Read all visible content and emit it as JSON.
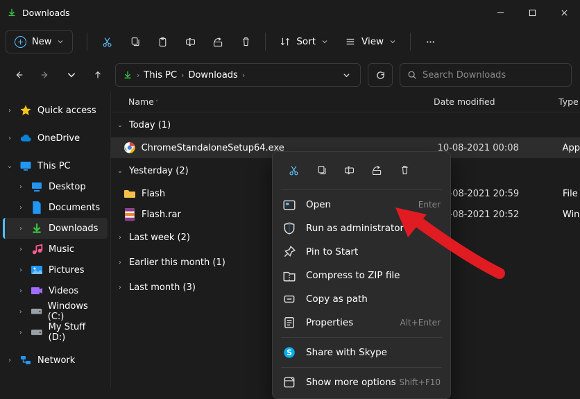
{
  "titlebar": {
    "title": "Downloads"
  },
  "toolbar": {
    "new_label": "New",
    "sort_label": "Sort",
    "view_label": "View"
  },
  "nav": {
    "crumbs": [
      "This PC",
      "Downloads"
    ],
    "search_placeholder": "Search Downloads"
  },
  "columns": {
    "name": "Name",
    "date": "Date modified",
    "type": "Type"
  },
  "sidebar": {
    "items": [
      {
        "label": "Quick access",
        "icon": "star",
        "color": "#f5c518",
        "expander": "›",
        "indent": false
      },
      {
        "label": "OneDrive",
        "icon": "cloud",
        "color": "#0a84d8",
        "expander": "›",
        "indent": false
      },
      {
        "label": "This PC",
        "icon": "monitor",
        "color": "#2196f3",
        "expander": "⌄",
        "indent": false
      },
      {
        "label": "Desktop",
        "icon": "desktop",
        "color": "#2196f3",
        "expander": "›",
        "indent": true
      },
      {
        "label": "Documents",
        "icon": "doc",
        "color": "#2196f3",
        "expander": "›",
        "indent": true
      },
      {
        "label": "Downloads",
        "icon": "download",
        "color": "#3ac143",
        "expander": "›",
        "indent": true,
        "selected": true
      },
      {
        "label": "Music",
        "icon": "music",
        "color": "#ff5a93",
        "expander": "›",
        "indent": true
      },
      {
        "label": "Pictures",
        "icon": "picture",
        "color": "#2196f3",
        "expander": "›",
        "indent": true
      },
      {
        "label": "Videos",
        "icon": "video",
        "color": "#a16cff",
        "expander": "›",
        "indent": true
      },
      {
        "label": "Windows (C:)",
        "icon": "drive",
        "color": "#9aa0a6",
        "expander": "›",
        "indent": true
      },
      {
        "label": "My Stuff (D:)",
        "icon": "drive",
        "color": "#9aa0a6",
        "expander": "›",
        "indent": true
      },
      {
        "label": "Network",
        "icon": "network",
        "color": "#2196f3",
        "expander": "›",
        "indent": false
      }
    ]
  },
  "groups": [
    {
      "label": "Today (1)",
      "expanded": true,
      "files": [
        {
          "name": "ChromeStandaloneSetup64.exe",
          "date": "10-08-2021 00:08",
          "type": "App",
          "icon": "chrome",
          "selected": true
        }
      ]
    },
    {
      "label": "Yesterday (2)",
      "expanded": true,
      "files": [
        {
          "name": "Flash",
          "date": "09-08-2021 20:59",
          "type": "File",
          "icon": "folder"
        },
        {
          "name": "Flash.rar",
          "date": "09-08-2021 20:52",
          "type": "Win",
          "icon": "rar"
        }
      ]
    },
    {
      "label": "Last week (2)",
      "expanded": false,
      "files": []
    },
    {
      "label": "Earlier this month (1)",
      "expanded": false,
      "files": []
    },
    {
      "label": "Last month (3)",
      "expanded": false,
      "files": []
    }
  ],
  "context_menu": {
    "items": [
      {
        "label": "Open",
        "icon": "open",
        "hint": "Enter"
      },
      {
        "label": "Run as administrator",
        "icon": "shield",
        "hint": ""
      },
      {
        "label": "Pin to Start",
        "icon": "pin",
        "hint": ""
      },
      {
        "label": "Compress to ZIP file",
        "icon": "zip",
        "hint": ""
      },
      {
        "label": "Copy as path",
        "icon": "copypath",
        "hint": ""
      },
      {
        "label": "Properties",
        "icon": "props",
        "hint": "Alt+Enter"
      },
      {
        "label": "Share with Skype",
        "icon": "skype",
        "hint": "",
        "sep_before": true
      },
      {
        "label": "Show more options",
        "icon": "more",
        "hint": "Shift+F10",
        "sep_before": true
      }
    ]
  },
  "arrow_color": "#e11b22"
}
